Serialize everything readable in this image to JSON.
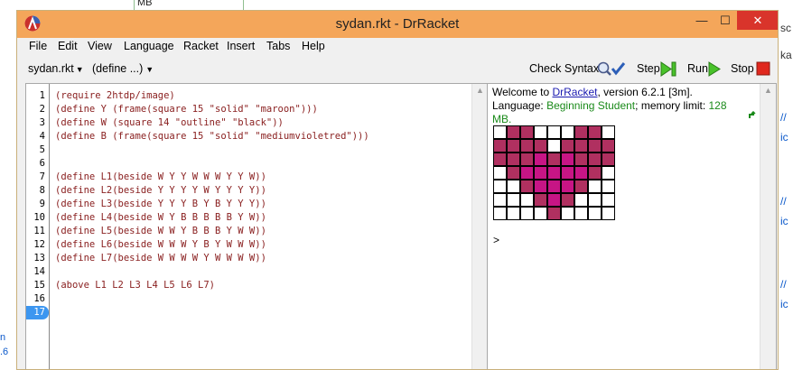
{
  "background": {
    "top_fragment": "MB",
    "right_fragments": [
      "sc",
      "ka",
      "//",
      "ic",
      "//",
      "ic",
      "//",
      "ic"
    ],
    "left_fragments": [
      "n",
      ".6"
    ]
  },
  "window": {
    "title": "sydan.rkt - DrRacket",
    "minimize": "—",
    "maximize": "☐",
    "close": "✕",
    "accent": "#f4a65a",
    "close_color": "#d9342b"
  },
  "menu": [
    "File",
    "Edit",
    "View",
    "Language",
    "Racket",
    "Insert",
    "Tabs",
    "Help"
  ],
  "toolbar": {
    "file_label": "sydan.rkt",
    "define_label": "(define ...)",
    "check_syntax": "Check Syntax",
    "step": "Step",
    "run": "Run",
    "stop": "Stop"
  },
  "editor": {
    "line_numbers": [
      "1",
      "2",
      "3",
      "4",
      "5",
      "6",
      "7",
      "8",
      "9",
      "10",
      "11",
      "12",
      "13",
      "14",
      "15",
      "16",
      "17"
    ],
    "current_line": "17",
    "lines": [
      "(require 2htdp/image)",
      "(define Y (frame(square 15 \"solid\" \"maroon\")))",
      "(define W (square 14 \"outline\" \"black\"))",
      "(define B (frame(square 15 \"solid\" \"mediumvioletred\")))",
      "",
      "",
      "(define L1(beside W Y Y W W W Y Y W))",
      "(define L2(beside Y Y Y Y W Y Y Y Y))",
      "(define L3(beside Y Y Y B Y B Y Y Y))",
      "(define L4(beside W Y B B B B B Y W))",
      "(define L5(beside W W Y B B B Y W W))",
      "(define L6(beside W W W Y B Y W W W))",
      "(define L7(beside W W W W Y W W W W))",
      "",
      "(above L1 L2 L3 L4 L5 L6 L7)",
      "",
      ""
    ]
  },
  "interactions": {
    "welcome_prefix": "Welcome to ",
    "welcome_link": "DrRacket",
    "welcome_suffix": ", version 6.2.1 [3m].",
    "lang_prefix": "Language: ",
    "lang_name": "Beginning Student",
    "lang_mid": "; memory limit: ",
    "mem_value": "128",
    "mem_unit": "MB.",
    "prompt": ">",
    "pixel_rows": [
      "WYYWWWYYW",
      "YYYYWYYYY",
      "YYYBYBYYY",
      "WYBBBBBYW",
      "WWYBBBYWW",
      "WWWYBYWWW",
      "WWWWYWWWW"
    ],
    "colors": {
      "Y": "#b03060",
      "B": "#c71585",
      "W": "#ffffff"
    }
  }
}
